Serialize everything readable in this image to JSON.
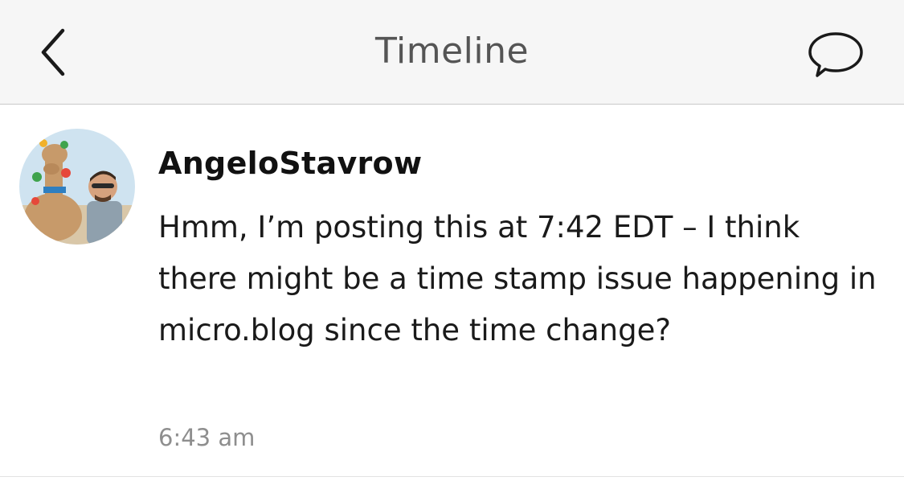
{
  "nav": {
    "title": "Timeline",
    "back_icon": "chevron-left-icon",
    "reply_icon": "speech-bubble-icon"
  },
  "post": {
    "username": "AngeloStavrow",
    "text": "Hmm, I’m posting this at 7:42 EDT – I think there might be a time stamp issue happening in micro.blog since the time change?",
    "timestamp": "6:43 am"
  },
  "colors": {
    "navbar_bg": "#f6f6f6",
    "title_text": "#555555",
    "body_text": "#1a1a1a",
    "timestamp_text": "#8e8e8e"
  }
}
